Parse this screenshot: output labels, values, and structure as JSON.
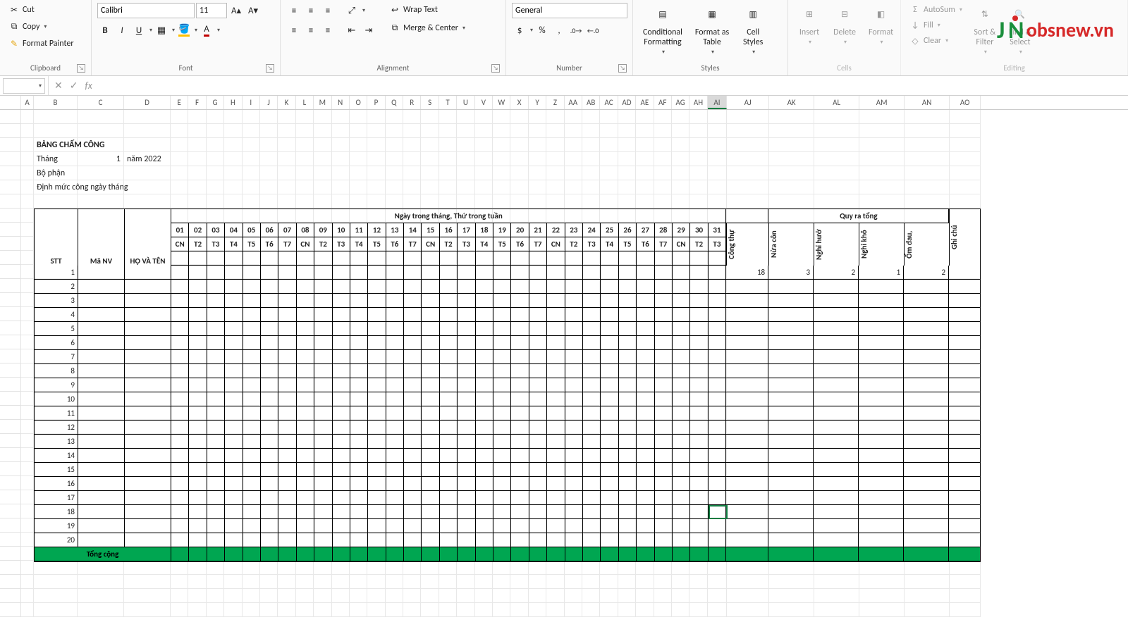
{
  "ribbon": {
    "clipboard": {
      "cut": "Cut",
      "copy": "Copy",
      "fp": "Format Painter",
      "label": "Clipboard"
    },
    "font": {
      "name": "Calibri",
      "size": "11",
      "label": "Font"
    },
    "alignment": {
      "wrap": "Wrap Text",
      "merge": "Merge & Center",
      "label": "Alignment"
    },
    "number": {
      "fmt": "General",
      "label": "Number"
    },
    "styles": {
      "cf": "Conditional\nFormatting",
      "fat": "Format as\nTable",
      "cs": "Cell\nStyles",
      "label": "Styles"
    },
    "cells": {
      "ins": "Insert",
      "del": "Delete",
      "fmt": "Format",
      "label": "Cells"
    },
    "editing": {
      "sum": "AutoSum",
      "fill": "Fill",
      "clear": "Clear",
      "sort": "Sort &\nFilter",
      "find": "Find &\nSelect",
      "label": "Editing"
    }
  },
  "namebox": "",
  "columns": [
    "A",
    "B",
    "C",
    "D",
    "E",
    "F",
    "G",
    "H",
    "I",
    "J",
    "K",
    "L",
    "M",
    "N",
    "O",
    "P",
    "Q",
    "R",
    "S",
    "T",
    "U",
    "V",
    "W",
    "X",
    "Y",
    "Z",
    "AA",
    "AB",
    "AC",
    "AD",
    "AE",
    "AF",
    "AG",
    "AH",
    "AI",
    "AJ",
    "AK",
    "AL",
    "AM",
    "AN",
    "AO"
  ],
  "col_sel": "AI",
  "info": {
    "title": "BẢNG CHẤM CÔNG",
    "month_lbl": "Tháng",
    "month_val": "1",
    "year": "năm 2022",
    "dept": "Bộ phận",
    "quota": "Định mức công ngày tháng"
  },
  "hdr": {
    "days_title": "Ngày trong tháng, Thứ trong tuần",
    "summary_title": "Quy ra tổng",
    "stt": "STT",
    "manv": "Mã NV",
    "hoten": "HỌ VÀ TÊN",
    "ghichu": "Ghi chú",
    "days": [
      "01",
      "02",
      "03",
      "04",
      "05",
      "06",
      "07",
      "08",
      "09",
      "10",
      "11",
      "12",
      "13",
      "14",
      "15",
      "16",
      "17",
      "18",
      "19",
      "20",
      "21",
      "22",
      "23",
      "24",
      "25",
      "26",
      "27",
      "28",
      "29",
      "30",
      "31"
    ],
    "wk": [
      "CN",
      "T2",
      "T3",
      "T4",
      "T5",
      "T6",
      "T7",
      "CN",
      "T2",
      "T3",
      "T4",
      "T5",
      "T6",
      "T7",
      "CN",
      "T2",
      "T3",
      "T4",
      "T5",
      "T6",
      "T7",
      "CN",
      "T2",
      "T3",
      "T4",
      "T5",
      "T6",
      "T7",
      "CN",
      "T2",
      "T3"
    ],
    "sumcols": [
      "Công thự",
      "Nửa côn",
      "Nghỉ hưở",
      "Nghỉ khô",
      "Ốm đau,"
    ]
  },
  "row1_sum": [
    "18",
    "3",
    "2",
    "1",
    "2"
  ],
  "total": "Tổng cộng",
  "watermark": "obsnew.vn"
}
